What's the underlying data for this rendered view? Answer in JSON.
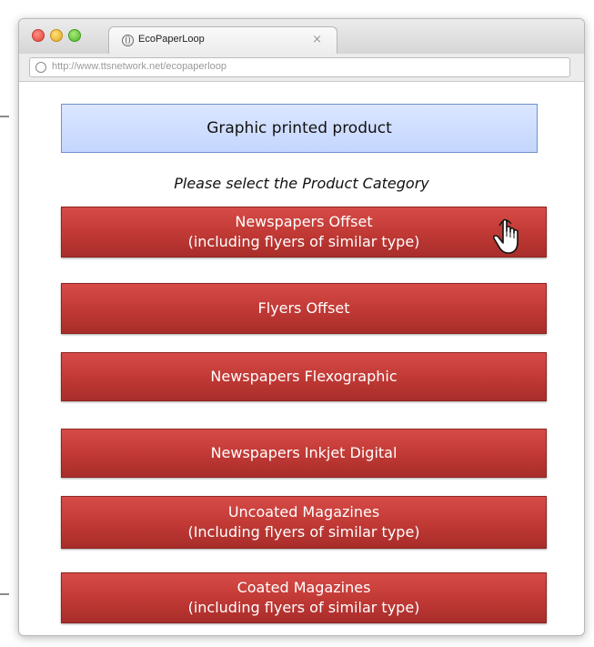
{
  "browser": {
    "tab_title": "EcoPaperLoop",
    "tab_close": "×",
    "url": "http://www.ttsnetwork.net/ecopaperloop"
  },
  "page": {
    "header": "Graphic printed product",
    "instruction": "Please select the Product Category"
  },
  "categories": [
    {
      "line1": "Newspapers Offset",
      "line2": "(including flyers of similar type)"
    },
    {
      "line1": "Flyers Offset",
      "line2": ""
    },
    {
      "line1": "Newspapers Flexographic",
      "line2": ""
    },
    {
      "line1": "Newspapers Inkjet Digital",
      "line2": ""
    },
    {
      "line1": "Uncoated Magazines",
      "line2": "(Including flyers of similar type)"
    },
    {
      "line1": "Coated Magazines",
      "line2": "(including flyers of similar type)"
    }
  ],
  "colors": {
    "button_red": "#c23a36",
    "header_blue": "#c9d9ff"
  },
  "icons": {
    "pointer": "hand-pointer-icon"
  }
}
